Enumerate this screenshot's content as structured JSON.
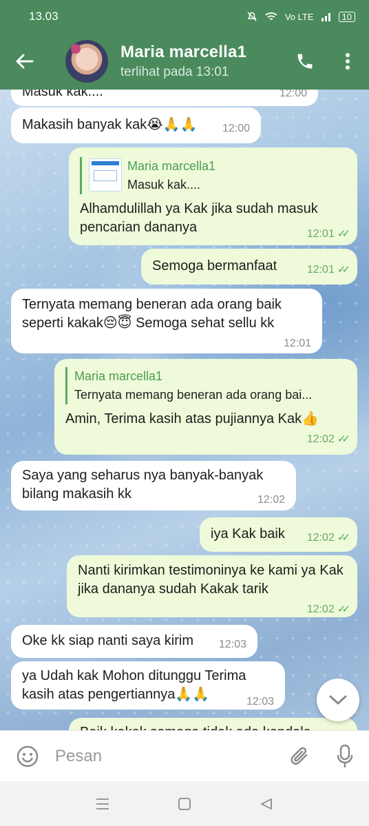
{
  "status_bar": {
    "time": "13.03",
    "battery": "10",
    "network": "Vo LTE"
  },
  "header": {
    "name": "Maria marcella1",
    "last_seen": "terlihat pada  13:01"
  },
  "messages": [
    {
      "dir": "in",
      "text": "Masuk kak....",
      "time": "12:00"
    },
    {
      "dir": "in",
      "text": "Makasih banyak kak😭🙏🙏",
      "time": "12:00"
    },
    {
      "dir": "out",
      "quote_name": "Maria marcella1",
      "quote_text": "Masuk kak....",
      "text": "Alhamdulillah ya Kak jika sudah masuk pencarian dananya",
      "time": "12:01",
      "ticks": "✓✓"
    },
    {
      "dir": "out",
      "text": "Semoga bermanfaat",
      "time": "12:01",
      "ticks": "✓✓"
    },
    {
      "dir": "in",
      "text": "Ternyata memang beneran ada orang baik seperti kakak😔😇 Semoga sehat sellu kk",
      "time": "12:01"
    },
    {
      "dir": "out",
      "quote_name": "Maria marcella1",
      "quote_text": "Ternyata memang beneran ada orang bai...",
      "text": "Amin, Terima kasih atas pujiannya Kak👍",
      "time": "12:02",
      "ticks": "✓✓"
    },
    {
      "dir": "in",
      "text": "Saya yang seharus nya banyak-banyak bilang makasih kk",
      "time": "12:02"
    },
    {
      "dir": "out",
      "text": "iya Kak baik",
      "time": "12:02",
      "ticks": "✓✓"
    },
    {
      "dir": "out",
      "text": "Nanti kirimkan testimoninya ke kami ya Kak jika dananya sudah Kakak tarik",
      "time": "12:02",
      "ticks": "✓✓"
    },
    {
      "dir": "in",
      "text": "Oke kk siap nanti saya kirim",
      "time": "12:03"
    },
    {
      "dir": "in",
      "text": "ya Udah kak Mohon ditunggu Terima kasih atas pengertiannya🙏🙏",
      "time": "12:03"
    },
    {
      "dir": "out",
      "text": "Baik kakak semoga tidak ada kendala",
      "time": ""
    }
  ],
  "input": {
    "placeholder": "Pesan"
  },
  "colors": {
    "header": "#4a8a5c",
    "bubble_out": "#eefad9",
    "bubble_in": "#ffffff",
    "accent": "#53a858"
  }
}
